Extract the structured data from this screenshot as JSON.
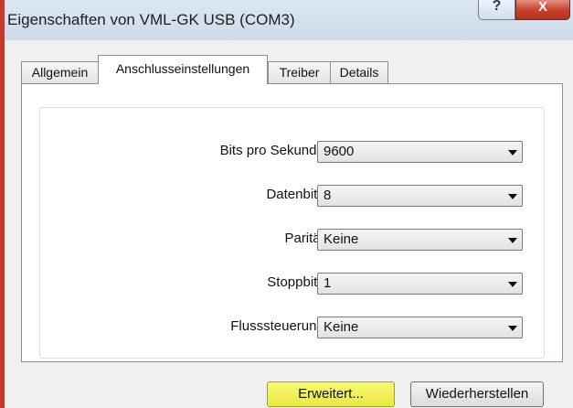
{
  "window": {
    "title": "Eigenschaften von VML-GK USB (COM3)",
    "help_glyph": "?",
    "close_glyph": "X"
  },
  "tabs": [
    {
      "label": "Allgemein",
      "active": false
    },
    {
      "label": "Anschlusseinstellungen",
      "active": true
    },
    {
      "label": "Treiber",
      "active": false
    },
    {
      "label": "Details",
      "active": false
    }
  ],
  "settings": {
    "bits": {
      "label": "Bits pro Sekunde:",
      "value": "9600"
    },
    "databits": {
      "label": "Datenbits:",
      "value": "8"
    },
    "parity": {
      "label": "Parität:",
      "value": "Keine"
    },
    "stopbits": {
      "label": "Stoppbits:",
      "value": "1"
    },
    "flow": {
      "label": "Flusssteuerung:",
      "value": "Keine"
    }
  },
  "buttons": {
    "advanced": "Erweitert...",
    "restore": "Wiederherstellen"
  },
  "colors": {
    "highlight": "#eded58",
    "close_red": "#c8422d"
  }
}
